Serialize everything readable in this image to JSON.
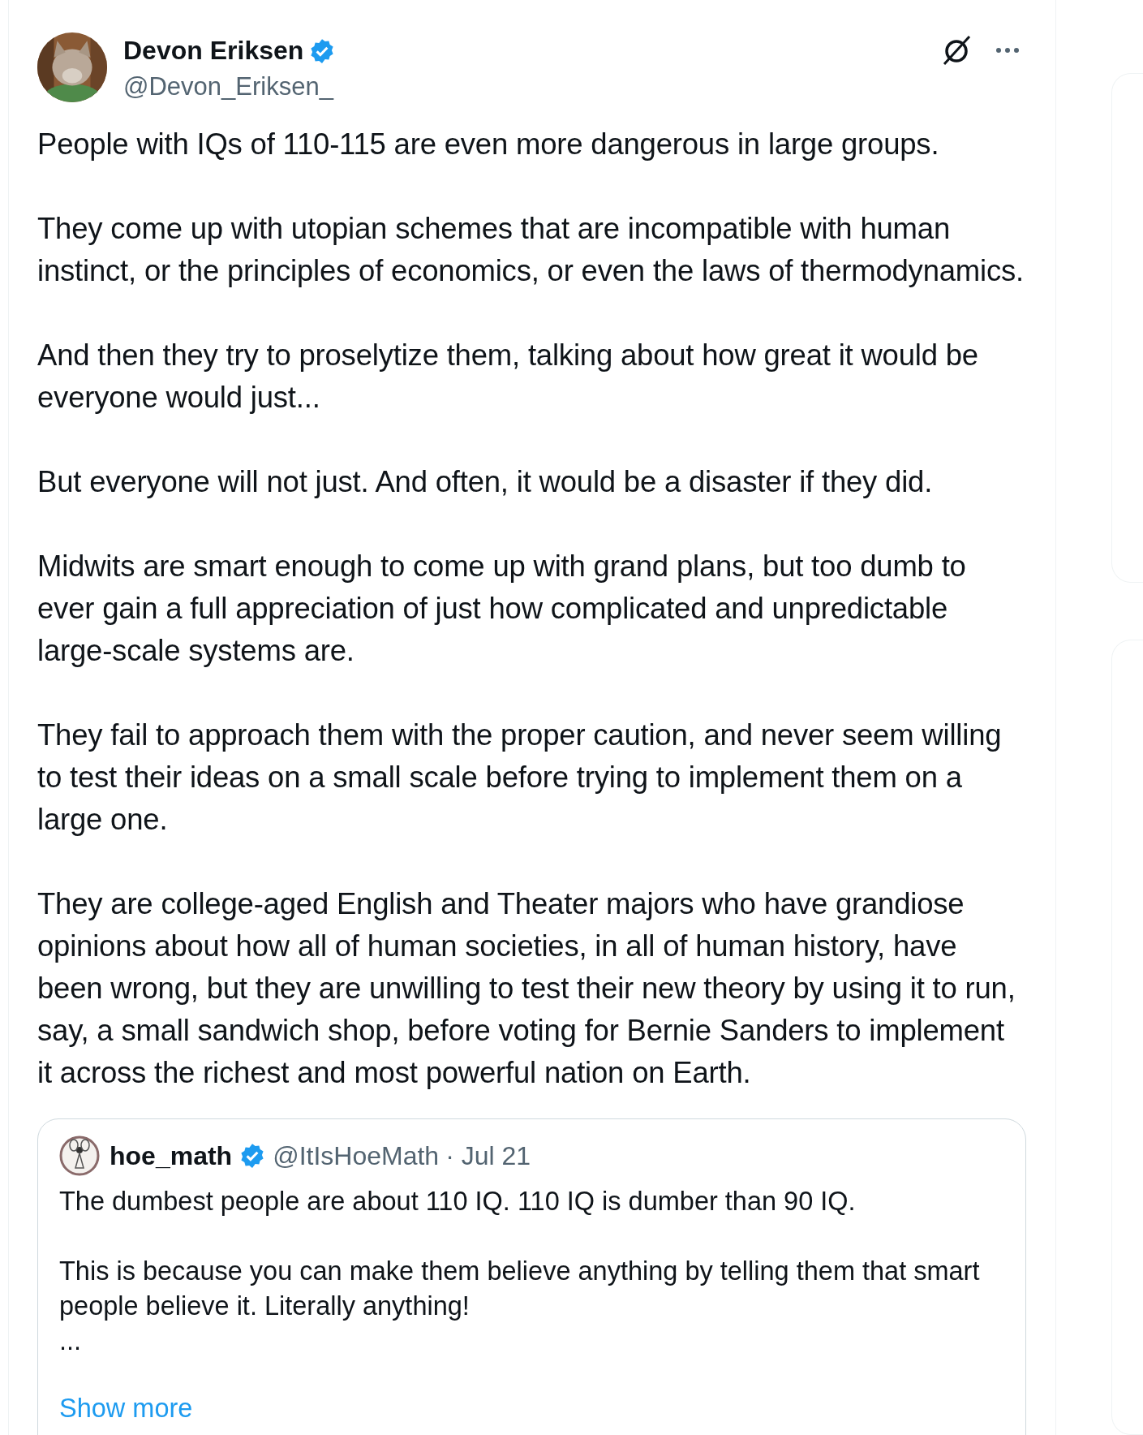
{
  "tweet": {
    "author": {
      "name": "Devon Eriksen",
      "handle": "@Devon_Eriksen_",
      "verified": true
    },
    "paragraphs": [
      "People with IQs of 110-115 are even more dangerous in large groups.",
      "They come up with utopian schemes that are incompatible with human instinct, or the principles of economics, or even the laws of thermodynamics.",
      "And then they try to proselytize them, talking about how great it would be everyone would just...",
      "But everyone will not just. And often, it would be a disaster if they did.",
      "Midwits are smart enough to come up with grand plans, but too dumb to ever gain a full appreciation of just how complicated and unpredictable large-scale systems are.",
      "They fail to approach them with the proper caution, and never seem willing to test their ideas on a small scale before trying to implement them on a large one.",
      "They are college-aged English and Theater majors who have grandiose opinions about how all of human societies, in all of human history, have been wrong, but they are unwilling to test their new theory by using it to run, say, a small sandwich shop, before voting for Bernie Sanders to implement it across the richest and most powerful nation on Earth."
    ],
    "quote": {
      "name": "hoe_math",
      "verified": true,
      "handle": "@ItIsHoeMath",
      "date": "· Jul 21",
      "paragraphs": [
        "The dumbest people are about 110 IQ. 110 IQ is dumber than 90 IQ.",
        "This is because you can make them believe anything by telling them that smart people believe it. Literally anything!",
        "..."
      ],
      "show_more": "Show more"
    }
  }
}
